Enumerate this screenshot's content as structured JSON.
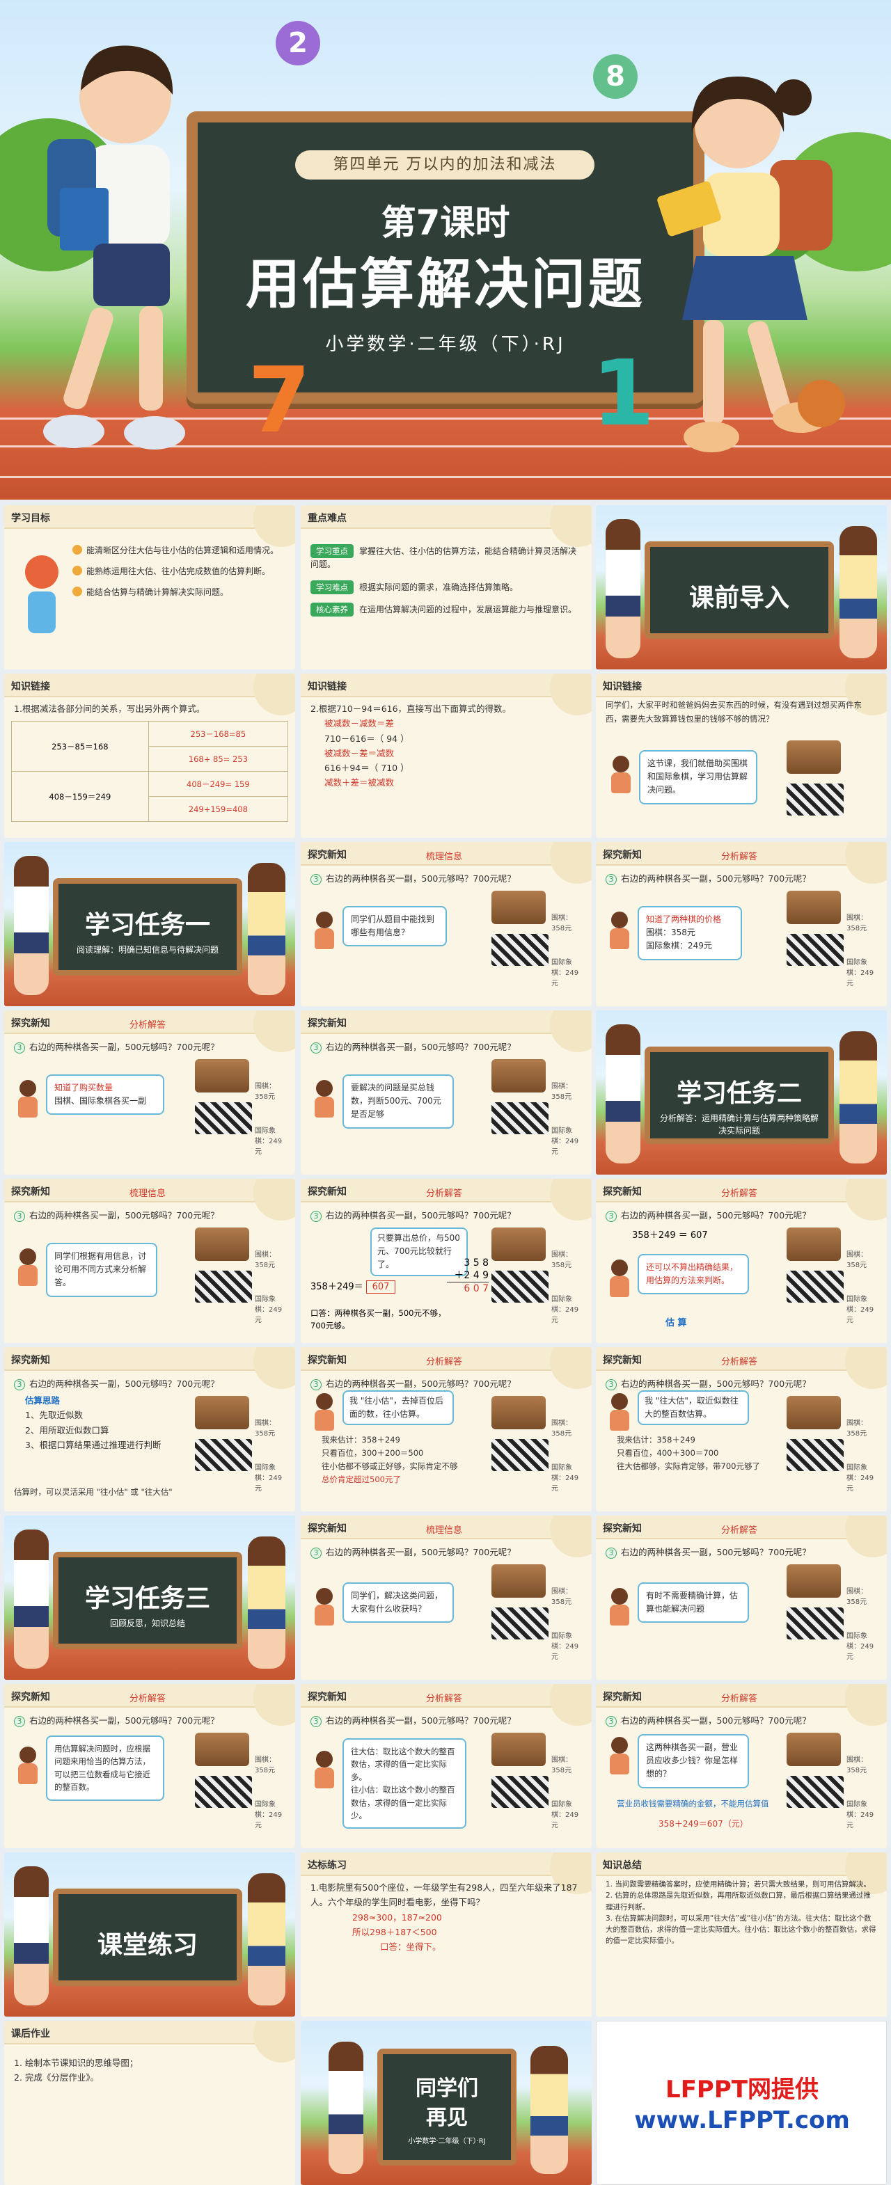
{
  "hero": {
    "unit": "第四单元  万以内的加法和减法",
    "lesson": "第7课时",
    "title": "用估算解决问题",
    "subtitle": "小学数学·二年级（下）·RJ",
    "bubble_left": "2",
    "bubble_right": "8",
    "char_left": "7",
    "char_right": "1"
  },
  "labels": {
    "tansuo": "探究新知",
    "shuli": "梳理信息",
    "fenxi": "分析解答",
    "zhishi": "知识链接"
  },
  "problem": "右边的两种棋各买一副，500元够吗？700元呢？",
  "prices": {
    "go": "围棋：358元",
    "chess": "国际象棋：249元"
  },
  "s_goals": {
    "title": "学习目标",
    "items": [
      "能清晰区分往大估与往小估的估算逻辑和适用情况。",
      "能熟练运用往大估、往小估完成数值的估算判断。",
      "能结合估算与精确计算解决实际问题。"
    ]
  },
  "s_key": {
    "title": "重点难点",
    "items": [
      {
        "chip": "学习重点",
        "text": "掌握往大估、往小估的估算方法，能结合精确计算灵活解决问题。"
      },
      {
        "chip": "学习难点",
        "text": "根据实际问题的需求，准确选择估算策略。"
      },
      {
        "chip": "核心素养",
        "text": "在运用估算解决问题的过程中，发展运算能力与推理意识。"
      }
    ]
  },
  "s_intro": {
    "title": "课前导入"
  },
  "s_link1": {
    "title": "知识链接",
    "intro": "1.根据减法各部分间的关系，写出另外两个算式。",
    "left": [
      "253－85＝168",
      "408－159＝249"
    ],
    "right": [
      "253－168=85",
      "168+ 85= 253",
      "408－249= 159",
      "249+159=408"
    ]
  },
  "s_link2": {
    "title": "知识链接",
    "intro": "2.根据710－94＝616，直接写出下面算式的得数。",
    "lines": [
      "被减数－减数＝差",
      "710－616＝（ 94 ）",
      "被减数－差＝减数",
      "616＋94＝（ 710 ）",
      "减数＋差＝被减数"
    ]
  },
  "s_link3": {
    "title": "知识链接",
    "intro": "同学们，大家平时和爸爸妈妈去买东西的时候，有没有遇到过想买两件东西，需要先大致算算钱包里的钱够不够的情况？",
    "speech": "这节课，我们就借助买围棋和国际象棋，学习用估算解决问题。"
  },
  "s_task1": {
    "title": "学习任务一",
    "sub": "阅读理解：明确已知信息与待解决问题"
  },
  "s_s1": {
    "speech": "同学们从题目中能找到哪些有用信息？"
  },
  "s_s2": {
    "speech": "知道了两种棋的价格",
    "l1": "围棋：358元",
    "l2": "国际象棋：249元"
  },
  "s_s3": {
    "speech": "知道了购买数量",
    "l1": "围棋、国际象棋各买一副"
  },
  "s_s4": {
    "speech": "要解决的问题是买总钱数，判断500元、700元是否足够"
  },
  "s_task2": {
    "title": "学习任务二",
    "sub": "分析解答：运用精确计算与估算两种策略解决实际问题"
  },
  "s_s5": {
    "speech": "同学们根据有用信息，讨论可用不同方式来分析解答。"
  },
  "s_s6": {
    "speech": "只要算出总价，与500元、700元比较就行了。",
    "eq": "358＋249＝",
    "ans": "607",
    "v": [
      "3 5 8",
      "＋2 4 9",
      "6 0 7"
    ],
    "foot": "口答：两种棋各买一副，500元不够，700元够。"
  },
  "s_s7": {
    "eq": "358＋249 ＝ 607",
    "speech": "还可以不算出精确结果，用估算的方法来判断。",
    "foot": "估 算"
  },
  "s_s8": {
    "title": "估算思路",
    "items": [
      "1、先取近似数",
      "2、用所取近似数口算",
      "3、根据口算结果通过推理进行判断"
    ],
    "foot": "估算时，可以灵活采用 \"往小估\" 或 \"往大估\""
  },
  "s_s9": {
    "speech": "我 \"往小估\"，去掉百位后面的数，往小估算。",
    "l1": "我来估计：358＋249",
    "l2": "只看百位，300＋200＝500",
    "l3": "往小估都不够或正好够，实际肯定不够",
    "l4": "总价肯定超过500元了"
  },
  "s_s10": {
    "speech": "我 \"往大估\"，取近似数往大的整百数估算。",
    "l1": "我来估计：358＋249",
    "l2": "只看百位，400＋300＝700",
    "l3": "往大估都够，实际肯定够，带700元够了"
  },
  "s_task3": {
    "title": "学习任务三",
    "sub": "回顾反思，知识总结"
  },
  "s_s11": {
    "speech": "同学们，解决这类问题，大家有什么收获吗？"
  },
  "s_s12": {
    "speech": "有时不需要精确计算，估算也能解决问题"
  },
  "s_s13": {
    "speech": "用估算解决问题时，应根据问题来用恰当的估算方法，可以把三位数看成与它接近的整百数。"
  },
  "s_s14": {
    "l1": "往大估：取比这个数大的整百数估，求得的值一定比实际多。",
    "l2": "往小估：取比这个数小的整百数估，求得的值一定比实际少。"
  },
  "s_s15": {
    "speech": "这两种棋各买一副，营业员应收多少钱？你是怎样想的？",
    "l1": "营业员收钱需要精确的金额，不能用估算值",
    "eq": "358＋249＝607（元）"
  },
  "s_practice": {
    "title": "课堂练习"
  },
  "s_test": {
    "title": "达标练习",
    "q": "1.电影院里有500个座位，一年级学生有298人，四至六年级来了187人。六个年级的学生同时看电影，坐得下吗？",
    "l1": "298≈300，187≈200",
    "l2": "所以298＋187＜500",
    "l3": "口答：坐得下。"
  },
  "s_sum": {
    "title": "知识总结",
    "items": [
      "1. 当问题需要精确答案时，应使用精确计算；若只需大致结果，则可用估算解决。",
      "2. 估算的总体思路是先取近似数，再用所取近似数口算，最后根据口算结果通过推理进行判断。",
      "3. 在估算解决问题时，可以采用“往大估”或“往小估”的方法。往大估：取比这个数大的整百数估，求得的值一定比实际值大。往小估：取比这个数小的整百数估，求得的值一定比实际值小。"
    ]
  },
  "s_hw": {
    "title": "课后作业",
    "items": [
      "1. 绘制本节课知识的思维导图；",
      "2. 完成《分层作业》。"
    ]
  },
  "s_bye": {
    "title1": "同学们",
    "title2": "再见",
    "sub": "小学数学·二年级（下）·RJ"
  },
  "s_logo": {
    "l1": "LFPPT网提供",
    "l2": "www.LFPPT.com"
  }
}
